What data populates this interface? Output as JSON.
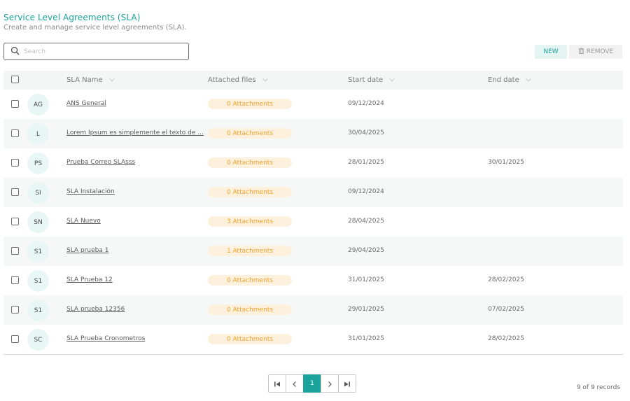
{
  "header": {
    "title": "Service Level Agreements (SLA)",
    "subtitle": "Create and manage service level agreements (SLA)."
  },
  "search": {
    "placeholder": "Search",
    "value": ""
  },
  "toolbar": {
    "new_label": "NEW",
    "remove_label": "REMOVE"
  },
  "table": {
    "columns": {
      "name": "SLA Name",
      "files": "Attached files",
      "start": "Start date",
      "end": "End date"
    },
    "rows": [
      {
        "initials": "AG",
        "name": "ANS General",
        "attachments": "0 Attachments",
        "start": "09/12/2024",
        "end": ""
      },
      {
        "initials": "L",
        "name": "Lorem Ipsum es simplemente el texto de ...",
        "attachments": "0 Attachments",
        "start": "30/04/2025",
        "end": ""
      },
      {
        "initials": "PS",
        "name": "Prueba Correo SLAsss",
        "attachments": "0 Attachments",
        "start": "28/01/2025",
        "end": "30/01/2025"
      },
      {
        "initials": "SI",
        "name": "SLA Instalación",
        "attachments": "0 Attachments",
        "start": "09/12/2024",
        "end": ""
      },
      {
        "initials": "SN",
        "name": "SLA Nuevo",
        "attachments": "3 Attachments",
        "start": "28/04/2025",
        "end": ""
      },
      {
        "initials": "S1",
        "name": "SLA prueba 1",
        "attachments": "1 Attachments",
        "start": "29/04/2025",
        "end": ""
      },
      {
        "initials": "S1",
        "name": "SLA Prueba 12",
        "attachments": "0 Attachments",
        "start": "31/01/2025",
        "end": "28/02/2025"
      },
      {
        "initials": "S1",
        "name": "SLA prueba 12356",
        "attachments": "0 Attachments",
        "start": "29/01/2025",
        "end": "07/02/2025"
      },
      {
        "initials": "SC",
        "name": "SLA Prueba Cronometros",
        "attachments": "0 Attachments",
        "start": "31/01/2025",
        "end": "28/02/2025"
      }
    ]
  },
  "pagination": {
    "current_page": "1",
    "records_text": "9 of 9 records"
  },
  "colors": {
    "accent": "#1aa39a",
    "attachment_pill_bg": "#fdf0dc",
    "attachment_pill_text": "#f0a32c",
    "avatar_bg": "#e8f6f5"
  },
  "icons": {
    "search": "search-icon",
    "remove": "trash-icon",
    "sort": "chevron-down-icon",
    "first": "first-page-icon",
    "prev": "chevron-left-icon",
    "next": "chevron-right-icon",
    "last": "last-page-icon"
  }
}
